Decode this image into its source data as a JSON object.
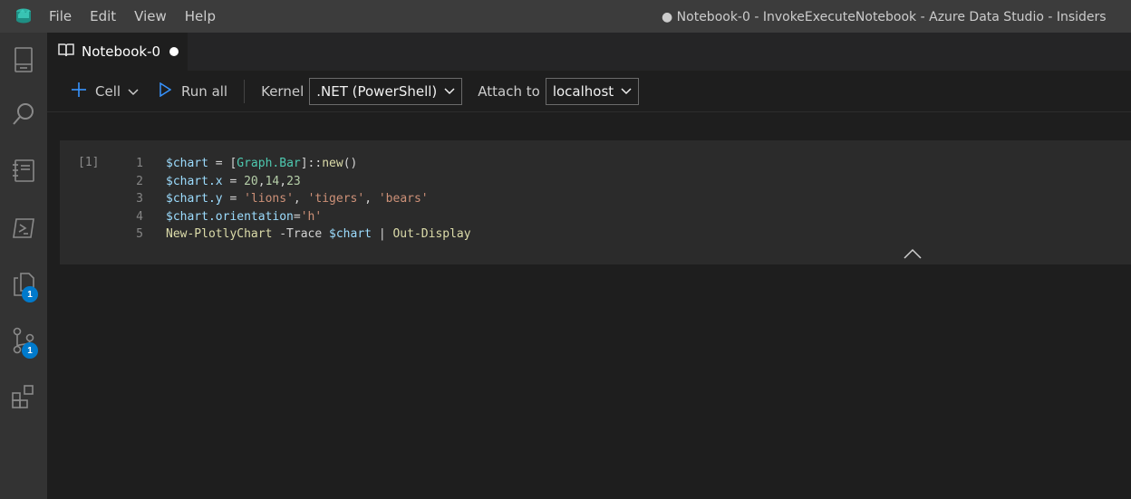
{
  "titlebar": {
    "menu": [
      "File",
      "Edit",
      "View",
      "Help"
    ],
    "window_title": "● Notebook-0 - InvokeExecuteNotebook - Azure Data Studio - Insiders"
  },
  "activitybar": {
    "items": [
      {
        "icon": "explorer-icon"
      },
      {
        "icon": "search-icon"
      },
      {
        "icon": "notebooks-icon"
      },
      {
        "icon": "terminal-icon"
      },
      {
        "icon": "pages-icon",
        "badge": "1"
      },
      {
        "icon": "source-control-icon",
        "badge": "1"
      },
      {
        "icon": "extensions-icon"
      }
    ]
  },
  "tab": {
    "label": "Notebook-0",
    "dirty": true
  },
  "toolbar": {
    "cell_label": "Cell",
    "run_all_label": "Run all",
    "kernel_label": "Kernel",
    "kernel_value": ".NET (PowerShell)",
    "attach_label": "Attach to",
    "attach_value": "localhost"
  },
  "cell": {
    "exec_count": "[1]",
    "lines": [
      {
        "n": "1",
        "tokens": [
          [
            "var",
            "$chart"
          ],
          [
            "op",
            " = ["
          ],
          [
            "type",
            "Graph.Bar"
          ],
          [
            "op",
            "]::"
          ],
          [
            "fn",
            "new"
          ],
          [
            "op",
            "()"
          ]
        ]
      },
      {
        "n": "2",
        "tokens": [
          [
            "var",
            "$chart.x"
          ],
          [
            "op",
            " = "
          ],
          [
            "num",
            "20"
          ],
          [
            "op",
            ","
          ],
          [
            "num",
            "14"
          ],
          [
            "op",
            ","
          ],
          [
            "num",
            "23"
          ]
        ]
      },
      {
        "n": "3",
        "tokens": [
          [
            "var",
            "$chart.y"
          ],
          [
            "op",
            " = "
          ],
          [
            "str",
            "'lions'"
          ],
          [
            "op",
            ", "
          ],
          [
            "str",
            "'tigers'"
          ],
          [
            "op",
            ", "
          ],
          [
            "str",
            "'bears'"
          ]
        ]
      },
      {
        "n": "4",
        "tokens": [
          [
            "var",
            "$chart.orientation"
          ],
          [
            "op",
            "="
          ],
          [
            "str",
            "'h'"
          ]
        ]
      },
      {
        "n": "5",
        "tokens": [
          [
            "fn",
            "New-PlotlyChart"
          ],
          [
            "op",
            " -Trace "
          ],
          [
            "var",
            "$chart"
          ],
          [
            "op",
            " | "
          ],
          [
            "fn",
            "Out-Display"
          ]
        ]
      }
    ]
  },
  "colors": {
    "accent": "#007acc",
    "run_icon": "#3794ff"
  }
}
